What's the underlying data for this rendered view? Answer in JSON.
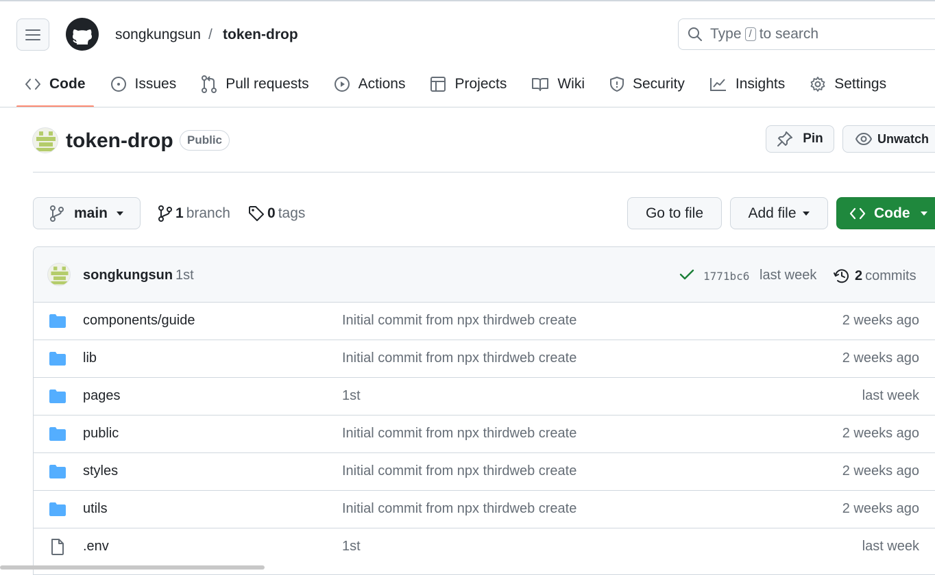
{
  "header": {
    "owner": "songkungsun",
    "separator": "/",
    "repo": "token-drop",
    "search_prefix": "Type",
    "search_key": "/",
    "search_suffix": "to search"
  },
  "tabs": [
    {
      "label": "Code",
      "icon": "code-icon",
      "active": true
    },
    {
      "label": "Issues",
      "icon": "issue-icon"
    },
    {
      "label": "Pull requests",
      "icon": "pull-request-icon"
    },
    {
      "label": "Actions",
      "icon": "play-icon"
    },
    {
      "label": "Projects",
      "icon": "table-icon"
    },
    {
      "label": "Wiki",
      "icon": "book-icon"
    },
    {
      "label": "Security",
      "icon": "shield-icon"
    },
    {
      "label": "Insights",
      "icon": "graph-icon"
    },
    {
      "label": "Settings",
      "icon": "gear-icon"
    }
  ],
  "repo_header": {
    "title": "token-drop",
    "visibility": "Public",
    "pin_label": "Pin",
    "watch_label": "Unwatch"
  },
  "branch_bar": {
    "branch": "main",
    "branch_count": "1",
    "branch_word": "branch",
    "tag_count": "0",
    "tag_word": "tags",
    "goto_file": "Go to file",
    "add_file": "Add file",
    "code": "Code"
  },
  "latest_commit": {
    "author": "songkungsun",
    "message": "1st",
    "sha": "1771bc6",
    "time": "last week",
    "commit_count": "2",
    "commit_word": "commits"
  },
  "files": [
    {
      "type": "dir",
      "name": "components/guide",
      "message": "Initial commit from npx thirdweb create",
      "age": "2 weeks ago"
    },
    {
      "type": "dir",
      "name": "lib",
      "message": "Initial commit from npx thirdweb create",
      "age": "2 weeks ago"
    },
    {
      "type": "dir",
      "name": "pages",
      "message": "1st",
      "age": "last week"
    },
    {
      "type": "dir",
      "name": "public",
      "message": "Initial commit from npx thirdweb create",
      "age": "2 weeks ago"
    },
    {
      "type": "dir",
      "name": "styles",
      "message": "Initial commit from npx thirdweb create",
      "age": "2 weeks ago"
    },
    {
      "type": "dir",
      "name": "utils",
      "message": "Initial commit from npx thirdweb create",
      "age": "2 weeks ago"
    },
    {
      "type": "file",
      "name": ".env",
      "message": "1st",
      "age": "last week"
    }
  ],
  "colors": {
    "accent_underline": "#fd8c73",
    "primary_button": "#1f883d",
    "folder": "#54aeff",
    "check": "#1a7f37"
  }
}
